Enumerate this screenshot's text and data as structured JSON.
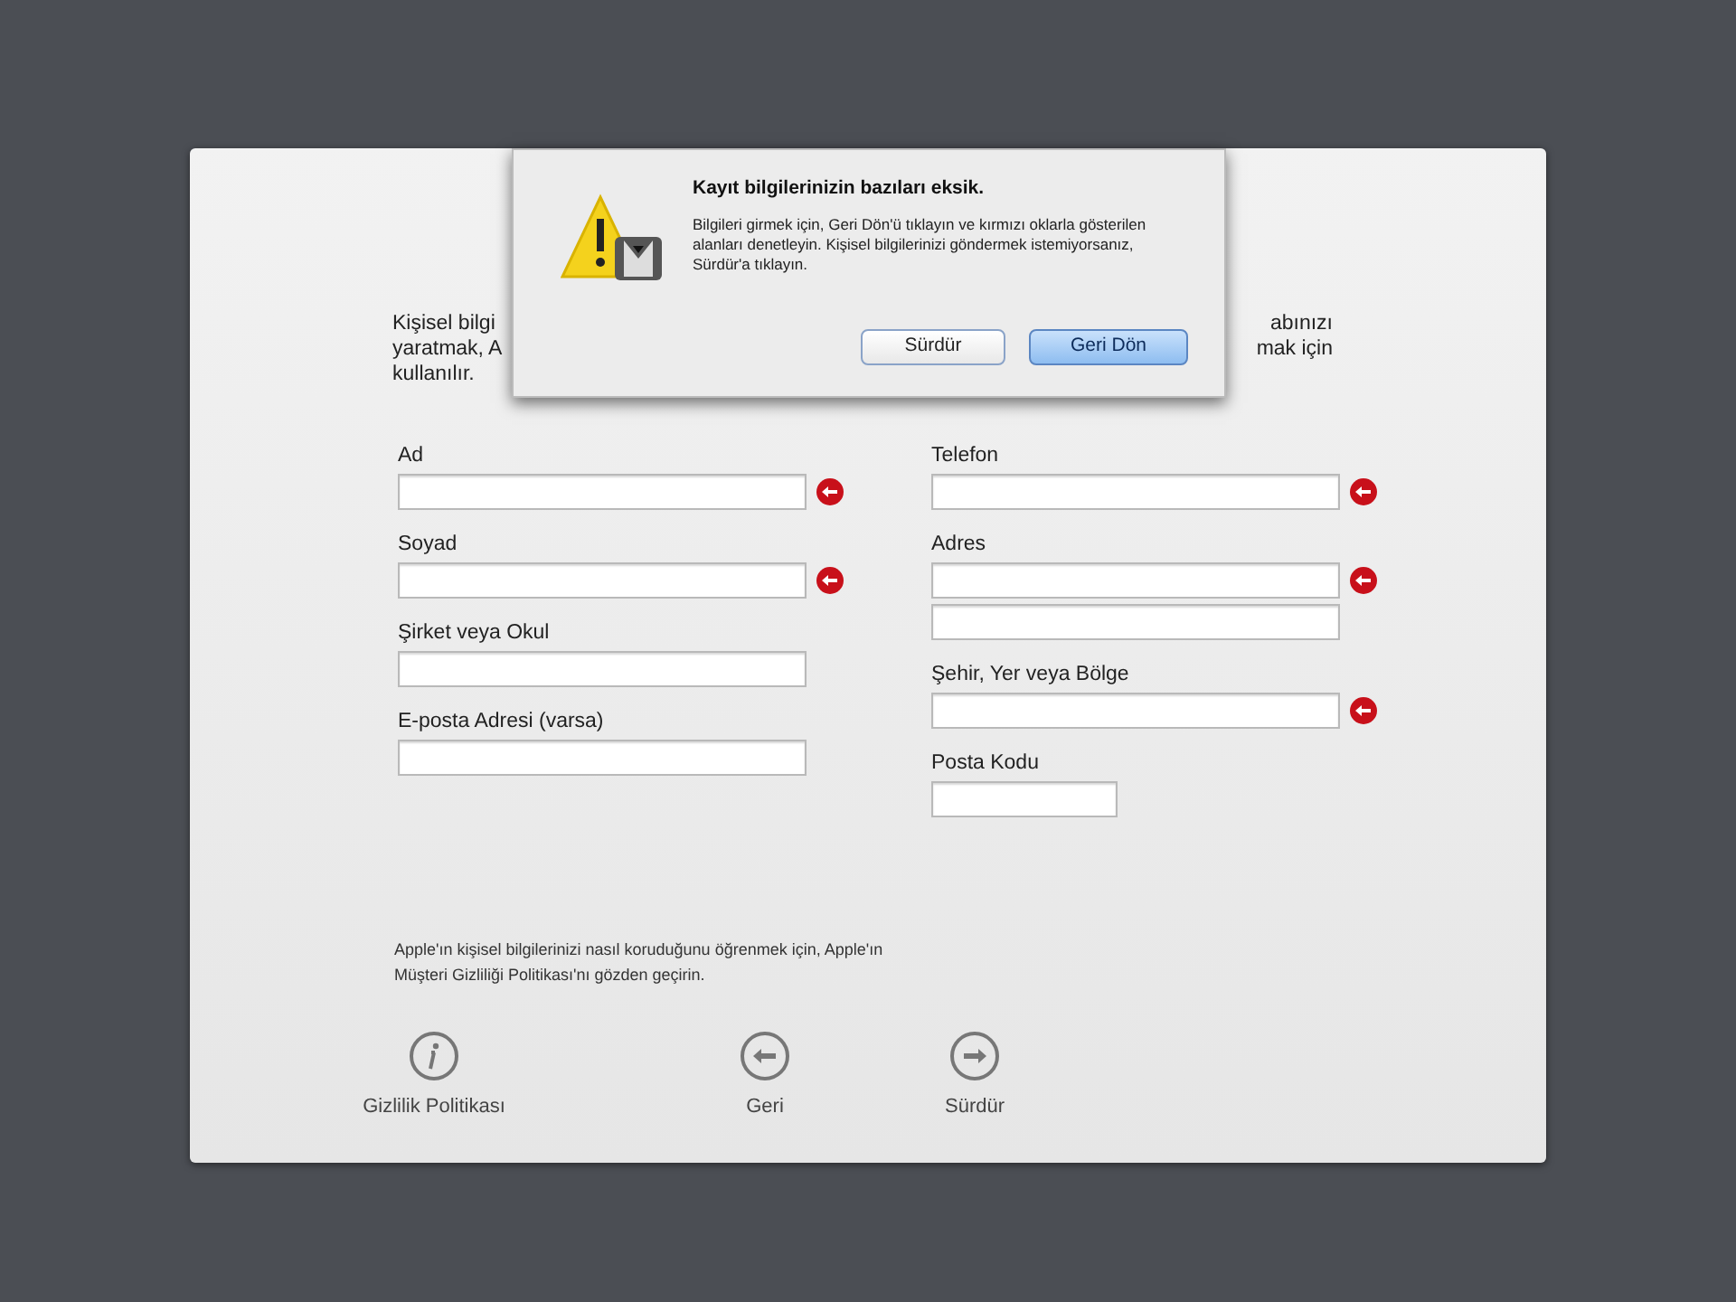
{
  "intro": {
    "lines": [
      {
        "left": "Kişisel bilgi",
        "right": "abınızı"
      },
      {
        "left": "yaratmak, A",
        "right": "mak için"
      },
      {
        "left": "kullanılır."
      }
    ]
  },
  "form": {
    "columns": [
      [
        {
          "label": "Ad",
          "kind": "standard",
          "error": true
        },
        {
          "label": "Soyad",
          "kind": "standard",
          "error": true
        },
        {
          "label": "Şirket veya Okul",
          "kind": "standard",
          "error": false
        },
        {
          "label": "E-posta Adresi (varsa)",
          "kind": "standard",
          "error": false
        }
      ],
      [
        {
          "label": "Telefon",
          "kind": "standard",
          "error": true
        },
        {
          "label": "Adres",
          "kind": "double",
          "error": true
        },
        {
          "label": "Şehir, Yer veya Bölge",
          "kind": "standard",
          "error": true
        },
        {
          "label": "Posta Kodu",
          "kind": "short",
          "error": false
        }
      ]
    ]
  },
  "privacy_note": "Apple'ın kişisel bilgilerinizi nasıl koruduğunu öğrenmek için, Apple'ın Müşteri Gizliliği Politikası'nı gözden geçirin.",
  "nav": [
    {
      "kind": "info",
      "label": "Gizlilik Politikası"
    },
    {
      "kind": "back",
      "label": "Geri"
    },
    {
      "kind": "forward",
      "label": "Sürdür"
    }
  ],
  "alert": {
    "title": "Kayıt bilgilerinizin bazıları eksik.",
    "message": "Bilgileri girmek için, Geri Dön'ü tıklayın ve kırmızı oklarla gösterilen alanları denetleyin. Kişisel bilgilerinizi göndermek istemiyorsanız, Sürdür'a tıklayın.",
    "buttons": [
      {
        "label": "Sürdür",
        "default": false
      },
      {
        "label": "Geri Dön",
        "default": true
      }
    ]
  }
}
